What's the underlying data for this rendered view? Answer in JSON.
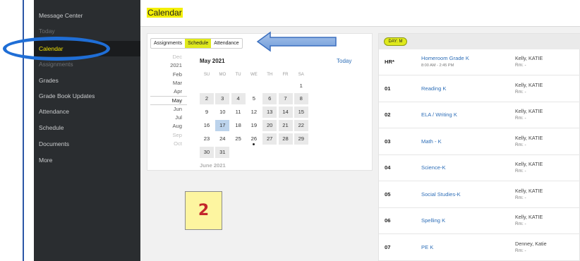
{
  "sidebar": {
    "items": [
      {
        "label": "Message Center"
      },
      {
        "label": "Today"
      },
      {
        "label": "Calendar"
      },
      {
        "label": "Assignments"
      },
      {
        "label": "Grades"
      },
      {
        "label": "Grade Book Updates"
      },
      {
        "label": "Attendance"
      },
      {
        "label": "Schedule"
      },
      {
        "label": "Documents"
      },
      {
        "label": "More"
      }
    ]
  },
  "header": {
    "title": "Calendar"
  },
  "tabs": [
    {
      "label": "Assignments"
    },
    {
      "label": "Schedule"
    },
    {
      "label": "Attendance"
    }
  ],
  "calendar": {
    "month_title": "May 2021",
    "today_label": "Today",
    "months": [
      "Dec",
      "2021",
      "Feb",
      "Mar",
      "Apr",
      "May",
      "Jun",
      "Jul",
      "Aug",
      "Sep",
      "Oct"
    ],
    "day_headers": [
      "SU",
      "MO",
      "TU",
      "WE",
      "TH",
      "FR",
      "SA"
    ],
    "weeks": [
      [
        "",
        "",
        "",
        "",
        "",
        "",
        "1"
      ],
      [
        "2",
        "3",
        "4",
        "5",
        "6",
        "7",
        "8"
      ],
      [
        "9",
        "10",
        "11",
        "12",
        "13",
        "14",
        "15"
      ],
      [
        "16",
        "17",
        "18",
        "19",
        "20",
        "21",
        "22"
      ],
      [
        "23",
        "24",
        "25",
        "26",
        "27",
        "28",
        "29"
      ],
      [
        "30",
        "31",
        "",
        "",
        "",
        "",
        ""
      ]
    ],
    "selected_day": "17",
    "event_day": "26",
    "next_month_label": "June 2021"
  },
  "annotation": {
    "number": "2"
  },
  "schedule": {
    "day_badge": "DAY: M",
    "rows": [
      {
        "period": "HR*",
        "course": "Homeroom Grade K",
        "time": "8:00 AM - 2:45 PM",
        "teacher": "Kelly, KATIE",
        "room": "Rm: -"
      },
      {
        "period": "01",
        "course": "Reading K",
        "teacher": "Kelly, KATIE",
        "room": "Rm: -"
      },
      {
        "period": "02",
        "course": "ELA / Writing K",
        "teacher": "Kelly, KATIE",
        "room": "Rm: -"
      },
      {
        "period": "03",
        "course": "Math - K",
        "teacher": "Kelly, KATIE",
        "room": "Rm: -"
      },
      {
        "period": "04",
        "course": "Science-K",
        "teacher": "Kelly, KATIE",
        "room": "Rm: -"
      },
      {
        "period": "05",
        "course": "Social Studies-K",
        "teacher": "Kelly, KATIE",
        "room": "Rm: -"
      },
      {
        "period": "06",
        "course": "Spelling K",
        "teacher": "Kelly, KATIE",
        "room": "Rm: -"
      },
      {
        "period": "07",
        "course": "PE K",
        "teacher": "Denney, Katie",
        "room": "Rm: -"
      }
    ]
  },
  "colors": {
    "highlight": "#f3ef05",
    "accent_blue": "#1f6ed6",
    "link": "#2f6fb8",
    "sidebar_bg": "#2a2d30"
  }
}
